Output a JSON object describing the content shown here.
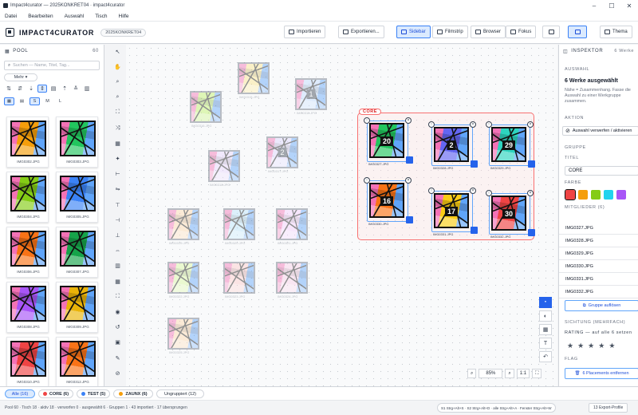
{
  "window": {
    "title": "Impact4curator — 2025KONKRET04 · impact4curator"
  },
  "menu": [
    "Datei",
    "Bearbeiten",
    "Auswahl",
    "Tisch",
    "Hilfe"
  ],
  "toolbar": {
    "brand": "IMPACT4CURATOR",
    "project": "2025KONKRET04",
    "import_label": "Importieren",
    "export_label": "Exportieren...",
    "views": [
      "Sidebar",
      "Filmstrip",
      "Browser",
      "Fokus"
    ],
    "active_view": "Sidebar",
    "theme_label": "Thema"
  },
  "pool": {
    "title": "POOL",
    "count": "60",
    "search_placeholder": "Suchen — Name, Titel, Tag...",
    "more_label": "Mehr ▾",
    "sizes": [
      "S",
      "M",
      "L"
    ],
    "active_size": "S",
    "items": [
      {
        "name": "IMG0302.JPG",
        "bg": "#f59e0b"
      },
      {
        "name": "IMG0303.JPG",
        "bg": "#22c55e"
      },
      {
        "name": "IMG0304.JPG",
        "bg": "#84cc16"
      },
      {
        "name": "IMG0305.JPG",
        "bg": "#3b82f6"
      },
      {
        "name": "IMG0306.JPG",
        "bg": "#f97316"
      },
      {
        "name": "IMG0307.JPG",
        "bg": "#16a34a"
      },
      {
        "name": "IMG0308.JPG",
        "bg": "#a855f7"
      },
      {
        "name": "IMG0309.JPG",
        "bg": "#eab308"
      },
      {
        "name": "IMG0310.JPG",
        "bg": "#ef4444"
      },
      {
        "name": "IMG0312.JPG",
        "bg": "#f97316"
      }
    ]
  },
  "canvas": {
    "ghosts": [
      {
        "name": "IMG0315.JPG",
        "bg": "#fde68a"
      },
      {
        "name": "IMG0311.JPG",
        "bg": "#bfdbfe",
        "num": "1"
      },
      {
        "name": "IMG0316.JPG",
        "bg": "#bef264"
      },
      {
        "name": "IMG0317.JPG",
        "bg": "#ddd6fe",
        "num": "2"
      },
      {
        "name": "IMG0318.JPG",
        "bg": "#e9d5ff"
      },
      {
        "name": "IMG0319.JPG",
        "bg": "#fed7aa"
      },
      {
        "name": "IMG0320.JPG",
        "bg": "#bae6fd"
      },
      {
        "name": "IMG0321.JPG",
        "bg": "#f5d0fe"
      },
      {
        "name": "IMG0322.JPG",
        "bg": "#d9f99d"
      },
      {
        "name": "IMG0323.JPG",
        "bg": "#fecaca"
      },
      {
        "name": "IMG0324.JPG",
        "bg": "#fbcfe8"
      },
      {
        "name": "IMG0325.JPG",
        "bg": "#fed7aa"
      }
    ],
    "group_label": "CORE",
    "tiles": [
      {
        "name": "IMG0327.JPG",
        "num": "20",
        "bg": "#22c55e"
      },
      {
        "name": "IMG0328.JPG",
        "num": "2",
        "bg": "#6366f1"
      },
      {
        "name": "IMG0329.JPG",
        "num": "29",
        "bg": "#2dd4bf"
      },
      {
        "name": "IMG0330.JPG",
        "num": "16",
        "bg": "#f97316"
      },
      {
        "name": "IMG0331.JPG",
        "num": "17",
        "bg": "#facc15"
      },
      {
        "name": "IMG0332.JPG",
        "num": "30",
        "bg": "#ef4444"
      }
    ],
    "zoom": "85%",
    "zoom_one": "1:1"
  },
  "inspector": {
    "title": "INSPEKTOR",
    "count": "6 Werke",
    "selection_heading": "AUSWAHL",
    "selection_title": "6 Werke ausgewählt",
    "selection_note": "Nähe = Zusammenhang. Fasse die Auswahl zu einer Werkgruppe zusammen.",
    "action_heading": "AKTION",
    "reject_label": "Auswahl verwerfen / aktivieren",
    "group_heading": "GRUPPE",
    "title_heading": "TITEL",
    "group_title": "CORE",
    "color_heading": "FARBE",
    "colors": [
      "#ef4444",
      "#f59e0b",
      "#84cc16",
      "#22d3ee",
      "#a855f7"
    ],
    "members_heading": "MITGLIEDER (6)",
    "members": [
      "IMG0327.JPG",
      "IMG0328.JPG",
      "IMG0329.JPG",
      "IMG0330.JPG",
      "IMG0331.JPG",
      "IMG0332.JPG"
    ],
    "dissolve_label": "Gruppe auflösen",
    "review_heading": "SICHTUNG (MEHRFACH)",
    "rating_label": "RATING — auf alle 6 setzen",
    "flag_heading": "FLAG",
    "remove_label": "6 Placements entfernen"
  },
  "filters": [
    {
      "label": "Alle (16)"
    },
    {
      "label": "CORE (6)",
      "color": "#ef4444"
    },
    {
      "label": "TEST (5)",
      "color": "#3b82f6"
    },
    {
      "label": "ZAUNX (6)",
      "color": "#f59e0b"
    },
    {
      "label": "Ungruppiert (12)"
    }
  ],
  "status": {
    "text": "Pool 60 · Tisch 18 · aktiv 18 · verworfen 0 · ausgewählt 6 · Gruppen 1 · 43 importiert · 17 übersprungen",
    "shortcuts": "S1 Strg+Alt+S · S2 Strg+Alt+D · alle Strg+Alt+A · Fenster Strg+Alt+W",
    "export": "13 Export-Profile"
  }
}
